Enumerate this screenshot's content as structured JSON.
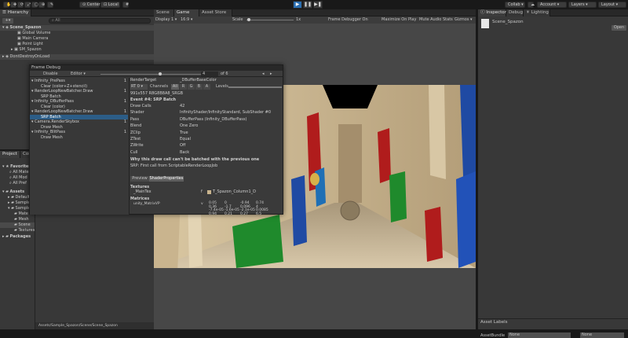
{
  "toolbar": {
    "center_label": "Center",
    "local_label": "Local",
    "collab_label": "Collab",
    "account_label": "Account",
    "layers_label": "Layers",
    "layout_label": "Layout"
  },
  "hierarchy": {
    "tab": "Hierarchy",
    "search_placeholder": "All",
    "items": [
      "Scene_Spazon",
      "Global Volume",
      "Main Camera",
      "Point Light",
      "SM_Spazon",
      "DontDestroyOnLoad"
    ]
  },
  "project": {
    "tabs": [
      "Project",
      "Console"
    ],
    "favorites_label": "Favorites",
    "favorites": [
      "All Mate",
      "All Mod",
      "All Pref"
    ],
    "assets_label": "Assets",
    "assets": [
      "Default",
      "Sample",
      "Sample",
      "Mate",
      "Mesh",
      "Scene",
      "Textures"
    ],
    "packages_label": "Packages",
    "path": "Assets/Sample_Spazon/Scene/Scene_Spazon"
  },
  "scene": {
    "tabs": [
      "Scene",
      "Game",
      "Asset Store"
    ],
    "display": "Display 1",
    "aspect": "16:9",
    "scale_label": "Scale",
    "scale_value": "1x",
    "frame_debugger_on": "Frame Debugger On",
    "maximize_on_play": "Maximize On Play",
    "mute_audio": "Mute Audio",
    "stats": "Stats",
    "gizmos": "Gizmos"
  },
  "inspector": {
    "tabs": [
      "Inspector",
      "Debug",
      "Lighting"
    ],
    "object_name": "Scene_Spazon",
    "open_label": "Open",
    "asset_labels": "Asset Labels",
    "asset_bundle_label": "AssetBundle",
    "asset_bundle_value": "None",
    "asset_bundle_variant": "None"
  },
  "frame_debug": {
    "title": "Frame Debug",
    "disable_label": "Disable",
    "target": "Editor",
    "current_event": "4",
    "event_total": "of 6",
    "tree": [
      {
        "label": "Infinity_PrePass",
        "indent": 0,
        "count": "1"
      },
      {
        "label": "Clear (color+Z+stencil)",
        "indent": 1,
        "count": ""
      },
      {
        "label": "RenderLoopNewBatcher.Draw",
        "indent": 0,
        "count": "1"
      },
      {
        "label": "SRP Batch",
        "indent": 1,
        "count": ""
      },
      {
        "label": "Infinity_DBufferPass",
        "indent": 0,
        "count": "1"
      },
      {
        "label": "Clear (color)",
        "indent": 1,
        "count": ""
      },
      {
        "label": "RenderLoopNewBatcher.Draw",
        "indent": 0,
        "count": "1"
      },
      {
        "label": "SRP Batch",
        "indent": 1,
        "count": "",
        "selected": true
      },
      {
        "label": "Camera.RenderSkybox",
        "indent": 0,
        "count": "1"
      },
      {
        "label": "Draw Mesh",
        "indent": 1,
        "count": ""
      },
      {
        "label": "Infinity_BlitPass",
        "indent": 0,
        "count": "1"
      },
      {
        "label": "Draw Mesh",
        "indent": 1,
        "count": ""
      }
    ],
    "render_target_label": "RenderTarget",
    "render_target": "_DBufferBaseColor",
    "rt": "RT 0",
    "channels_label": "Channels",
    "channels": [
      "All",
      "R",
      "G",
      "B",
      "A"
    ],
    "levels_label": "Levels",
    "format": "991x557 R8G8B8A8_SRGB",
    "event_title": "Event #4: SRP Batch",
    "props": [
      {
        "k": "Draw Calls",
        "v": "42"
      },
      {
        "k": "Shader",
        "v": "InfinityShader/InfinityStandard, SubShader #0"
      },
      {
        "k": "Pass",
        "v": "DBufferPass (Infinity_DBufferPass)"
      },
      {
        "k": "Blend",
        "v": "One Zero"
      },
      {
        "k": "ZClip",
        "v": "True"
      },
      {
        "k": "ZTest",
        "v": "Equal"
      },
      {
        "k": "ZWrite",
        "v": "Off"
      },
      {
        "k": "Cull",
        "v": "Back"
      }
    ],
    "why_title": "Why this draw call can't be batched with the previous one",
    "why_text": "SRP: First call from ScriptableRenderLoopJob",
    "bottom_tabs": [
      "Preview",
      "ShaderProperties"
    ],
    "textures_label": "Textures",
    "tex_name": "_MainTex",
    "tex_stage": "f",
    "tex_value": "T_Spazon_Column1_D",
    "matrices_label": "Matrices",
    "matrix_name": "unity_MatrixVP",
    "matrix_stage": "v",
    "matrix": [
      [
        "0.05",
        "0",
        "-0.94",
        "0.74"
      ],
      [
        "0.36",
        "-1.7",
        "0.096",
        "4"
      ],
      [
        "-7.4e-05",
        "-1.6e-05",
        "-2.1e-05",
        "0.0085"
      ],
      [
        "0.94",
        "0.21",
        "0.27",
        "6.5"
      ]
    ]
  }
}
